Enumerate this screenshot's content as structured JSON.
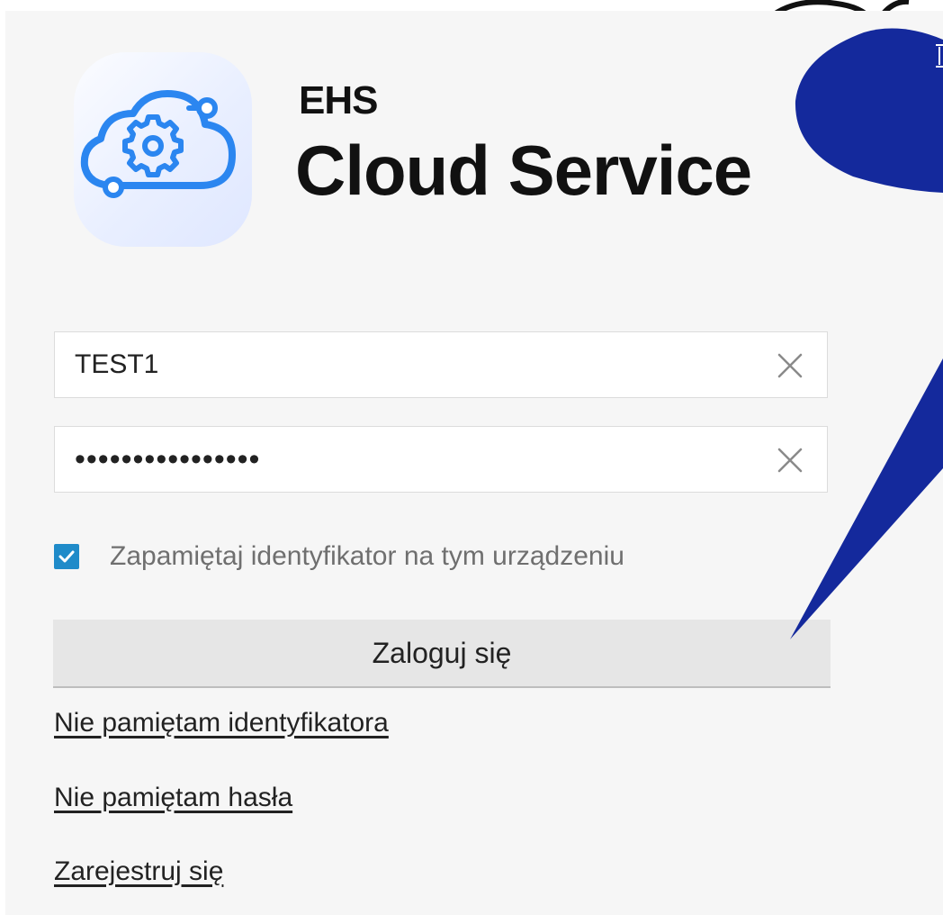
{
  "brand": {
    "line1": "EHS",
    "line2": "Cloud Service"
  },
  "form": {
    "username_value": "TEST1",
    "password_value": "••••••••••••••••",
    "remember_label": "Zapamiętaj identyfikator na tym urządzeniu",
    "remember_checked": true,
    "login_button": "Zaloguj się"
  },
  "links": {
    "forgot_id": "Nie pamiętam identyfikatora",
    "forgot_password": "Nie pamiętam hasła",
    "register": "Zarejestruj się"
  },
  "icons": {
    "logo": "cloud-gear-icon",
    "clear": "close-icon",
    "check": "checkmark-icon"
  },
  "colors": {
    "accent_blue": "#1f8bc9",
    "callout_blue": "#14299c",
    "logo_blue": "#2b86f0"
  }
}
